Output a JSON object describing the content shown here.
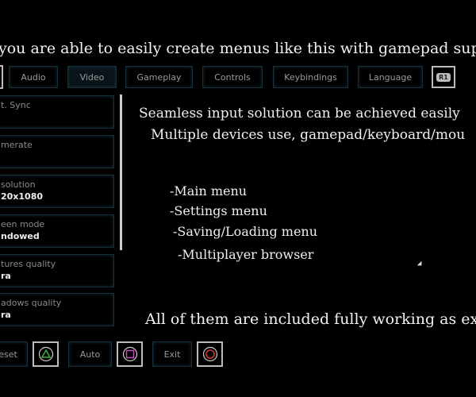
{
  "banner": "you are able to easily create menus like this with gamepad supp",
  "tabs": [
    {
      "label": "Audio"
    },
    {
      "label": "Video",
      "active": true
    },
    {
      "label": "Gameplay"
    },
    {
      "label": "Controls"
    },
    {
      "label": "Keybindings"
    },
    {
      "label": "Language"
    }
  ],
  "right_bumper": "R1",
  "settings": [
    {
      "label": "t. Sync",
      "value": ""
    },
    {
      "label": "merate",
      "value": ""
    },
    {
      "label": "solution",
      "value": "20x1080"
    },
    {
      "label": "een mode",
      "value": "ndowed"
    },
    {
      "label": "tures quality",
      "value": "ra"
    },
    {
      "label": "adows quality",
      "value": "ra"
    }
  ],
  "text": {
    "line1": "Seamless input solution can be achieved easily",
    "line2": "Multiple devices use, gamepad/keyboard/mou",
    "list": [
      "-Main menu",
      "-Settings menu",
      "-Saving/Loading menu",
      "-Multiplayer browser"
    ],
    "footer": "All of them are included fully working as exa"
  },
  "bottom": {
    "reset": "eset",
    "auto": "Auto",
    "exit": "Exit",
    "colors": {
      "triangle": "#3fae3f",
      "square": "#c04fc0",
      "circle": "#d83434"
    }
  }
}
